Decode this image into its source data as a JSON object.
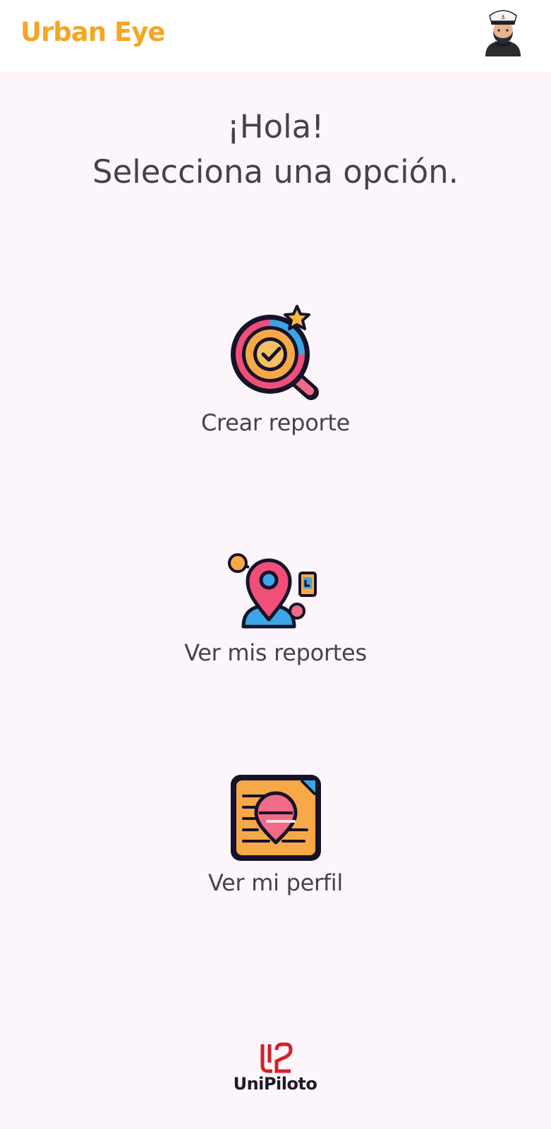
{
  "app": {
    "title": "Urban Eye",
    "accent_color": "#f5a623",
    "background_color": "#fcf5fc",
    "avatar_icon": "sailor-avatar-icon"
  },
  "greeting": {
    "line1": "¡Hola!",
    "line2": "Selecciona una opción."
  },
  "options": [
    {
      "label": "Crear reporte",
      "icon": "magnifier-check-star-icon"
    },
    {
      "label": "Ver mis reportes",
      "icon": "location-pin-user-icon"
    },
    {
      "label": "Ver mi perfil",
      "icon": "profile-document-icon"
    }
  ],
  "footer": {
    "brand": "UniPiloto",
    "logo_icon": "unipiloto-logo-icon",
    "logo_color": "#d42027"
  }
}
